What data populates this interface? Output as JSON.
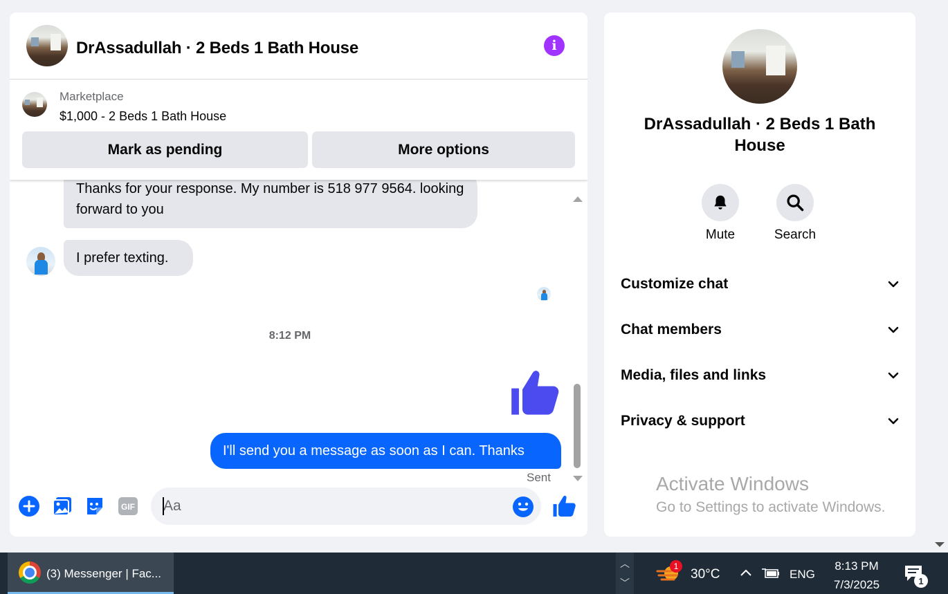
{
  "chat": {
    "title": "DrAssadullah · 2 Beds 1 Bath House",
    "marketplace": {
      "label": "Marketplace",
      "listing": "$1,000 - 2 Beds 1 Bath House",
      "pending_label": "Mark as pending",
      "more_label": "More options"
    },
    "messages": {
      "received_1": "Thanks for your response. My number is 518 977 9564. looking forward to you",
      "received_2": "I prefer texting.",
      "timestamp": "8:12 PM",
      "sent_1": "I'll send you a message as soon as I can. Thanks",
      "status": "Sent"
    },
    "composer": {
      "placeholder": "Aa"
    }
  },
  "details": {
    "title": "DrAssadullah · 2 Beds 1 Bath House",
    "mute_label": "Mute",
    "search_label": "Search",
    "sections": {
      "customize": "Customize chat",
      "members": "Chat members",
      "media": "Media, files and links",
      "privacy": "Privacy & support"
    }
  },
  "watermark": {
    "title": "Activate Windows",
    "subtitle": "Go to Settings to activate Windows."
  },
  "taskbar": {
    "app_label": "(3) Messenger | Fac...",
    "weather_badge": "1",
    "temperature": "30°C",
    "language": "ENG",
    "time": "8:13 PM",
    "date": "7/3/2025",
    "notification_count": "1"
  },
  "colors": {
    "accent": "#0866ff",
    "like": "#4b4bf0",
    "info": "#a033ff"
  }
}
